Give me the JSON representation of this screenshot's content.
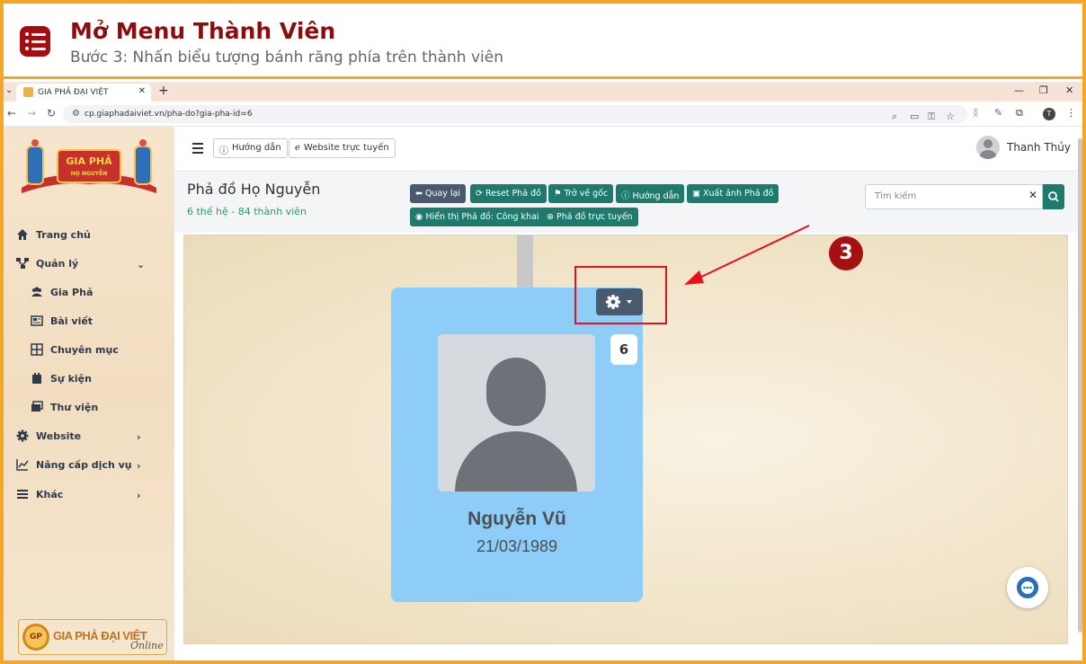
{
  "tutorial": {
    "title": "Mở Menu Thành Viên",
    "subtitle": "Bước 3: Nhấn biểu tượng bánh răng phía trên thành viên",
    "step_number": "3"
  },
  "browser": {
    "tab_title": "GIA PHẢ ĐẠI VIỆT",
    "url": "cp.giaphadaiviet.vn/pha-do?gia-pha-id=6",
    "profile_initial": "T"
  },
  "sidebar": {
    "logo_text_top": "GIA PHẢ",
    "logo_text_bottom": "HỌ NGUYỄN",
    "items": [
      {
        "label": "Trang chủ",
        "icon": "home-icon"
      },
      {
        "label": "Quản lý",
        "icon": "sitemap-icon"
      },
      {
        "label": "Gia Phả",
        "icon": "users-icon"
      },
      {
        "label": "Bài viết",
        "icon": "newspaper-icon"
      },
      {
        "label": "Chuyên mục",
        "icon": "grid-icon"
      },
      {
        "label": "Sự kiện",
        "icon": "calendar-icon"
      },
      {
        "label": "Thư viện",
        "icon": "images-icon"
      },
      {
        "label": "Website",
        "icon": "gear-icon"
      },
      {
        "label": "Nâng cấp dịch vụ",
        "icon": "chart-icon"
      },
      {
        "label": "Khác",
        "icon": "bars-icon"
      }
    ],
    "brand_seal": "GP",
    "brand_text": "GIA PHẢ ĐẠI VIỆT",
    "brand_online": "Online"
  },
  "topbar": {
    "guide_label": "Hướng dẫn",
    "website_label": "Website trực tuyến",
    "user_name": "Thanh Thủy"
  },
  "page": {
    "title": "Phả đồ Họ Nguyễn",
    "meta": "6 thế hệ - 84 thành viên",
    "actions": [
      "Quay lại",
      "Reset Phả đồ",
      "Trở về gốc",
      "Hướng dẫn",
      "Xuất ảnh Phả đồ",
      "Hiển thị Phả đồ: Công khai",
      "Phả đồ trực tuyến"
    ],
    "search_placeholder": "Tìm kiếm"
  },
  "member": {
    "name": "Nguyễn Vũ",
    "birth_date": "21/03/1989",
    "generation_badge": "6"
  },
  "colors": {
    "brand_red": "#a51012",
    "card_blue": "#8ecdf8",
    "teal": "#1d7a6c",
    "dark_button": "#4a5a6e",
    "highlight": "#e8111b"
  }
}
